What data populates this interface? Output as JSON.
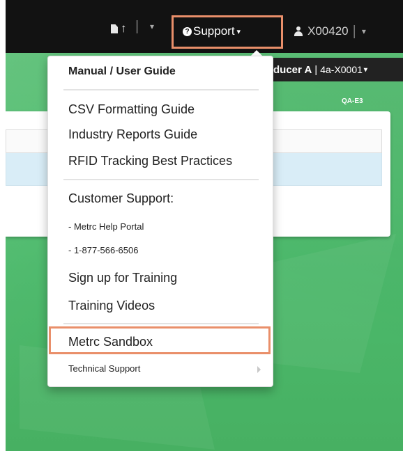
{
  "navbar": {
    "support_label": "Support",
    "user_label": "X00420",
    "separator": "|",
    "caret": "▾"
  },
  "facility": {
    "name": "ducer A",
    "separator": "|",
    "license": "4a-X0001",
    "caret": "▾"
  },
  "environment_label": "QA-E3",
  "support_menu": {
    "header": "Manual / User Guide",
    "items": [
      {
        "label": "CSV Formatting Guide"
      },
      {
        "label": "Industry Reports Guide"
      },
      {
        "label": "RFID Tracking Best Practices"
      }
    ],
    "customer_support": {
      "heading": "Customer Support:",
      "help_portal": "- Metrc Help Portal",
      "phone": "- 1-877-566-6506",
      "training_signup": "Sign up for Training",
      "training_videos": "Training Videos"
    },
    "sandbox": "Metrc Sandbox",
    "technical_support": "Technical Support"
  },
  "colors": {
    "navbar_bg": "#121212",
    "highlight_outline": "#e98f6a",
    "background_green": "#4cb96b",
    "row_highlight": "#d9edf7"
  }
}
